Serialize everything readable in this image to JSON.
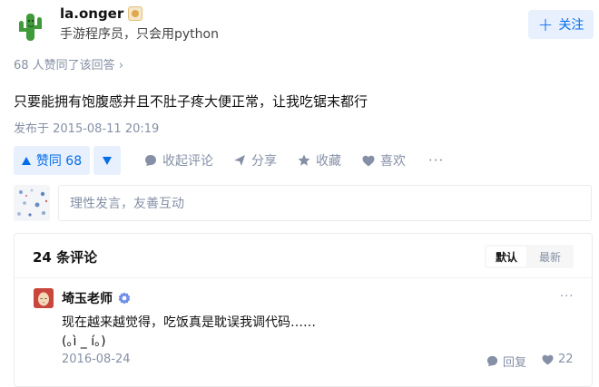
{
  "author": {
    "name": "la.onger",
    "headline": "手游程序员，只会用python",
    "follow_label": "关注"
  },
  "answer": {
    "voters_text": "68 人赞同了该回答",
    "content": "只要能拥有饱腹感并且不肚子疼大便正常，让我吃锯末都行",
    "published": "发布于 2015-08-11 20:19"
  },
  "actions": {
    "upvote_label": "赞同 68",
    "comment_label": "收起评论",
    "share_label": "分享",
    "collect_label": "收藏",
    "like_label": "喜欢",
    "more_label": "···"
  },
  "composer": {
    "placeholder": "理性发言，友善互动"
  },
  "comments": {
    "count_label": "24 条评论",
    "sort": [
      "默认",
      "最新"
    ],
    "items": [
      {
        "author": "埼玉老师",
        "line1": "现在越来越觉得，吃饭真是耽误我调代码……",
        "line2": "(｡ì _ í｡)",
        "time": "2016-08-24",
        "reply_label": "回复",
        "likes": "22"
      }
    ]
  },
  "colors": {
    "accent": "#056de8",
    "accent_bg": "#e8f0fe",
    "muted": "#8590a6"
  }
}
